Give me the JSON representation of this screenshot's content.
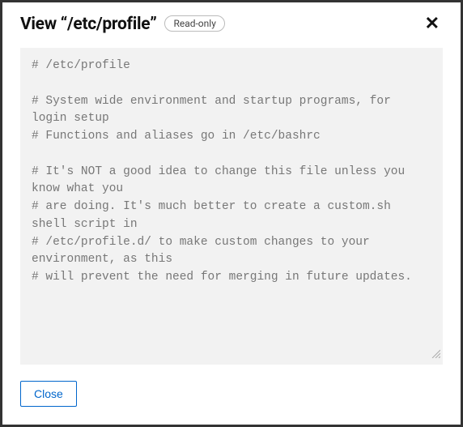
{
  "header": {
    "title_prefix": "View",
    "file_path": "/etc/profile",
    "badge": "Read-only",
    "close_symbol": "✕"
  },
  "file_content": "# /etc/profile\n\n# System wide environment and startup programs, for login setup\n# Functions and aliases go in /etc/bashrc\n\n# It's NOT a good idea to change this file unless you know what you\n# are doing. It's much better to create a custom.sh shell script in\n# /etc/profile.d/ to make custom changes to your environment, as this\n# will prevent the need for merging in future updates.\n\n",
  "footer": {
    "close_label": "Close"
  }
}
